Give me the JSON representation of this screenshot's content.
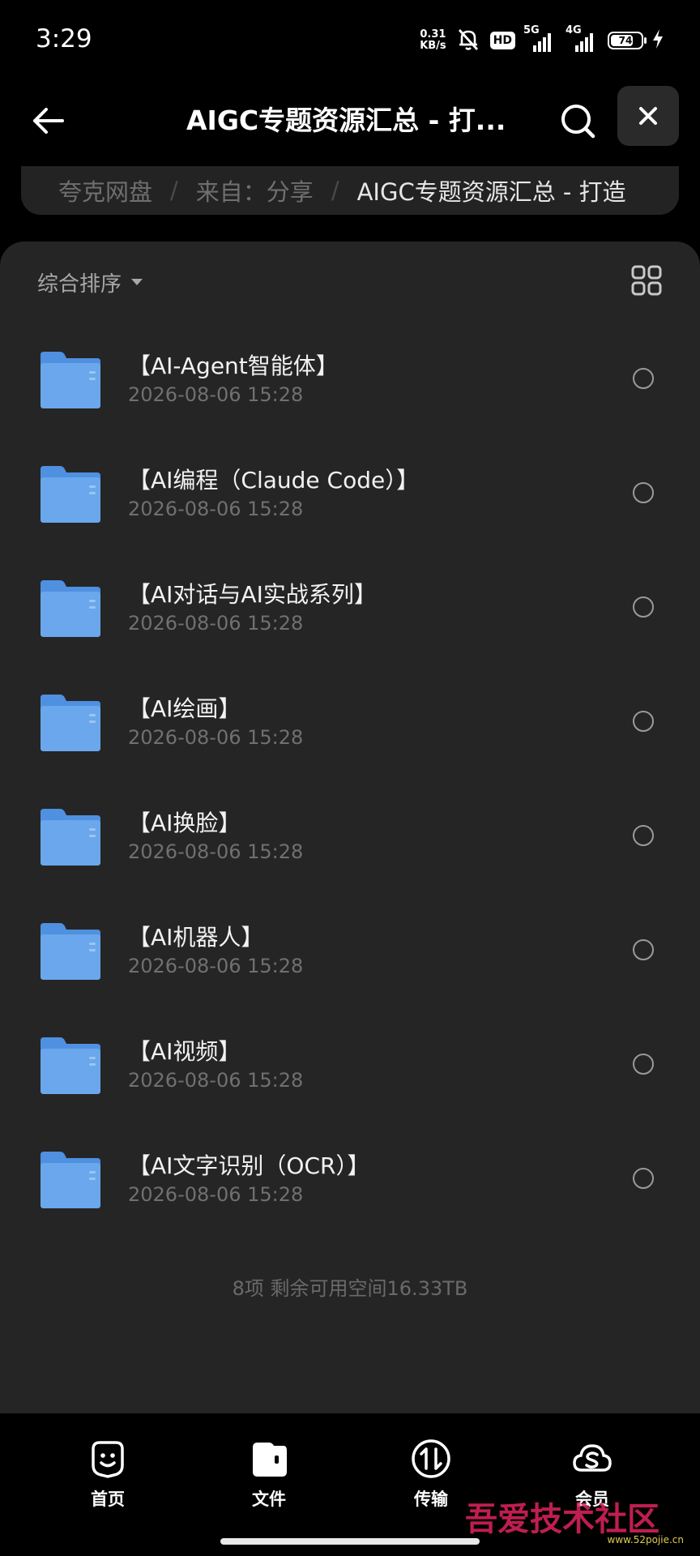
{
  "status_bar": {
    "time": "3:29",
    "net_speed_value": "0.31",
    "net_speed_unit": "KB/s",
    "hd_badge": "HD",
    "signal1_label": "5G",
    "signal2_label": "4G",
    "battery_level": "74",
    "battery_fraction": 0.74
  },
  "topbar": {
    "title": "AIGC专题资源汇总 - 打..."
  },
  "breadcrumb": {
    "items": [
      "夸克网盘",
      "来自：分享"
    ],
    "separator": "/",
    "current": "AIGC专题资源汇总 - 打造"
  },
  "toolbar": {
    "sort_label": "综合排序"
  },
  "files": [
    {
      "name": "【AI-Agent智能体】",
      "date": "2026-08-06 15:28"
    },
    {
      "name": "【AI编程（Claude Code）】",
      "date": "2026-08-06 15:28"
    },
    {
      "name": "【AI对话与AI实战系列】",
      "date": "2026-08-06 15:28"
    },
    {
      "name": "【AI绘画】",
      "date": "2026-08-06 15:28"
    },
    {
      "name": "【AI换脸】",
      "date": "2026-08-06 15:28"
    },
    {
      "name": "【AI机器人】",
      "date": "2026-08-06 15:28"
    },
    {
      "name": "【AI视频】",
      "date": "2026-08-06 15:28"
    },
    {
      "name": "【AI文字识别（OCR）】",
      "date": "2026-08-06 15:28"
    }
  ],
  "summary": "8项 剩余可用空间16.33TB",
  "bottom_nav": [
    {
      "label": "首页",
      "icon": "smile-icon"
    },
    {
      "label": "文件",
      "icon": "wallet-icon"
    },
    {
      "label": "传输",
      "icon": "transfer-icon"
    },
    {
      "label": "会员",
      "icon": "cloud-s-icon"
    }
  ],
  "watermark": {
    "text": "吾爱技术社区",
    "url": "www.52pojie.cn"
  },
  "colors": {
    "background": "#000000",
    "panel": "#252525",
    "breadcrumb_bg": "#232323",
    "folder_blue": "#6aa7ec",
    "text_primary": "#f2f2f2",
    "text_secondary": "#707070"
  }
}
